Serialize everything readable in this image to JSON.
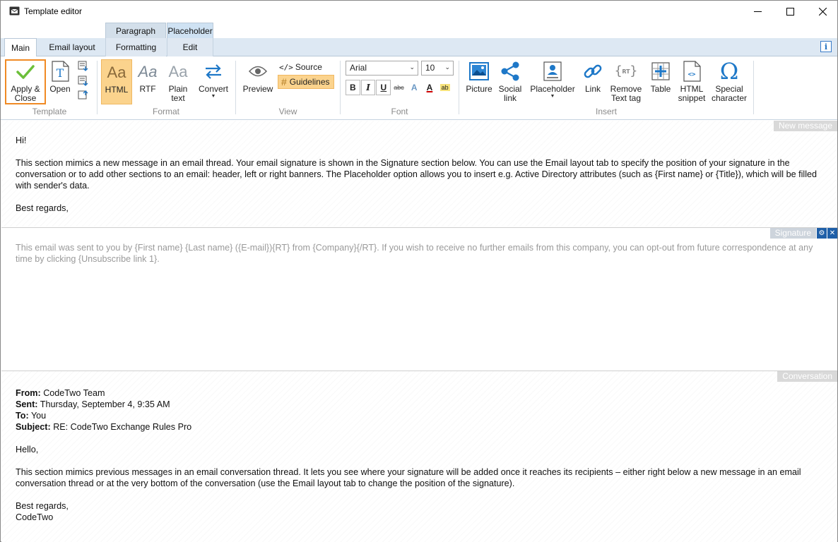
{
  "window": {
    "title": "Template editor"
  },
  "context_tabs": {
    "paragraph": "Paragraph",
    "placeholder": "Placeholder"
  },
  "tabs": {
    "main": "Main",
    "email_layout": "Email layout",
    "formatting": "Formatting",
    "edit": "Edit"
  },
  "ribbon": {
    "template": {
      "apply_close_1": "Apply &",
      "apply_close_2": "Close",
      "open": "Open",
      "group": "Template"
    },
    "format": {
      "html": "HTML",
      "rtf": "RTF",
      "plain_1": "Plain",
      "plain_2": "text",
      "convert": "Convert",
      "group": "Format"
    },
    "view": {
      "preview": "Preview",
      "source": "Source",
      "guidelines": "Guidelines",
      "group": "View"
    },
    "font": {
      "family": "Arial",
      "size": "10",
      "bold": "B",
      "italic": "I",
      "underline": "U",
      "strike": "abc",
      "group": "Font"
    },
    "insert": {
      "picture": "Picture",
      "social_1": "Social",
      "social_2": "link",
      "placeholder": "Placeholder",
      "link": "Link",
      "remove_1": "Remove",
      "remove_2": "Text tag",
      "table": "Table",
      "html_1": "HTML",
      "html_2": "snippet",
      "special_1": "Special",
      "special_2": "character",
      "group": "Insert"
    }
  },
  "sections": {
    "new_message": {
      "label": "New message",
      "greeting": "Hi!",
      "paragraph": "This section mimics a new message in an email thread. Your email signature is shown in the Signature section below. You can use the Email layout tab to specify the position of your signature in the conversation or to add other sections to an email: header, left or right banners. The Placeholder option allows you to insert e.g. Active Directory attributes (such as {First name} or {Title}), which will be filled with sender's data.",
      "closing": "Best regards,"
    },
    "signature": {
      "label": "Signature",
      "text": "This email was sent to you by {First name} {Last name} ({E-mail}){RT} from {Company}{/RT}. If you wish to receive no further emails from this company, you can opt-out from future correspondence at any time by clicking {Unsubscribe link 1}."
    },
    "conversation": {
      "label": "Conversation",
      "from_label": "From:",
      "from": "CodeTwo Team",
      "sent_label": "Sent:",
      "sent": "Thursday, September 4, 9:35 AM",
      "to_label": "To:",
      "to": "You",
      "subject_label": "Subject:",
      "subject": "RE: CodeTwo Exchange Rules Pro",
      "greeting": "Hello,",
      "paragraph": "This section mimics previous messages in an email conversation thread. It lets you see where your signature will be added once it reaches its recipients – either right below a new message in an email conversation thread or at the very bottom of the conversation (use the Email layout tab to change the position of the signature).",
      "closing_1": "Best regards,",
      "closing_2": "CodeTwo"
    }
  }
}
